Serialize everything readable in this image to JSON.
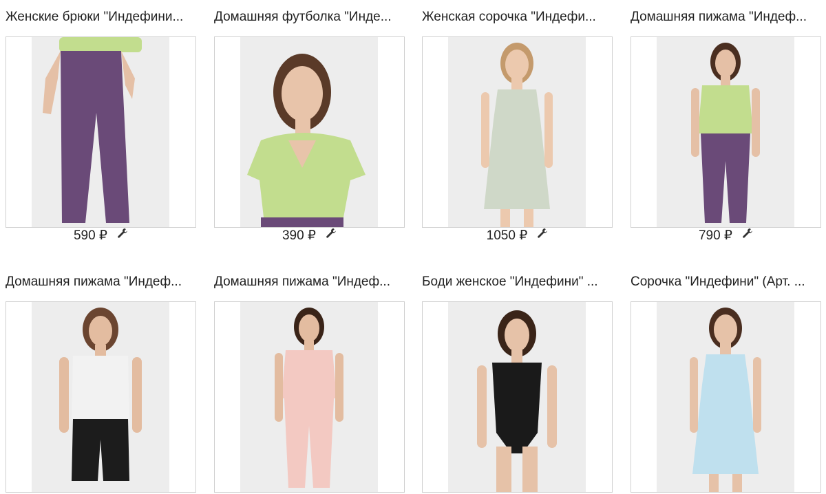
{
  "products": [
    {
      "title": "Женские брюки \"Индефини...",
      "price": "590 ₽",
      "photo": {
        "bg": "#ededed",
        "skin": "#e5c0a6",
        "hair": "#5a3a28",
        "top": "#c2dd8e",
        "bottom": "#6a4a78",
        "pose": "pants-closeup"
      }
    },
    {
      "title": "Домашняя футболка \"Инде...",
      "price": "390 ₽",
      "photo": {
        "bg": "#ededed",
        "skin": "#e8c4aa",
        "hair": "#5a3a28",
        "top": "#c2dd8e",
        "bottom": "#6a4a78",
        "pose": "portrait"
      }
    },
    {
      "title": "Женская сорочка \"Индефи...",
      "price": "1050 ₽",
      "photo": {
        "bg": "#ededed",
        "skin": "#ecc9ae",
        "hair": "#c49a6c",
        "top": "#cfd8c8",
        "bottom": "#cfd8c8",
        "pose": "dress"
      }
    },
    {
      "title": "Домашняя пижама \"Индеф...",
      "price": "790 ₽",
      "photo": {
        "bg": "#ededed",
        "skin": "#e5c0a6",
        "hair": "#4a2e20",
        "top": "#c2dd8e",
        "bottom": "#6a4a78",
        "pose": "full"
      }
    },
    {
      "title": "Домашняя пижама \"Индеф...",
      "price": "",
      "photo": {
        "bg": "#ededed",
        "skin": "#e3bca0",
        "hair": "#6b4530",
        "top": "#f2f2f2",
        "bottom": "#1c1c1c",
        "pose": "shorts"
      }
    },
    {
      "title": "Домашняя пижама \"Индеф...",
      "price": "",
      "photo": {
        "bg": "#ededed",
        "skin": "#e3bca0",
        "hair": "#3a2418",
        "top": "#f3c9c2",
        "bottom": "#f3c9c2",
        "pose": "full"
      }
    },
    {
      "title": "Боди женское \"Индефини\" ...",
      "price": "",
      "photo": {
        "bg": "#ededed",
        "skin": "#e6c2a8",
        "hair": "#3a2418",
        "top": "#1a1a1a",
        "bottom": "#1a1a1a",
        "pose": "body"
      }
    },
    {
      "title": "Сорочка \"Индефини\" (Арт. ...",
      "price": "",
      "photo": {
        "bg": "#ededed",
        "skin": "#e6c2a8",
        "hair": "#4a2e20",
        "top": "#bfe0ee",
        "bottom": "#bfe0ee",
        "pose": "dress"
      }
    }
  ],
  "icons": {
    "price_action": "wrench-icon"
  },
  "colors": {
    "text": "#222222",
    "border": "#cfcfcf",
    "background": "#ffffff"
  }
}
